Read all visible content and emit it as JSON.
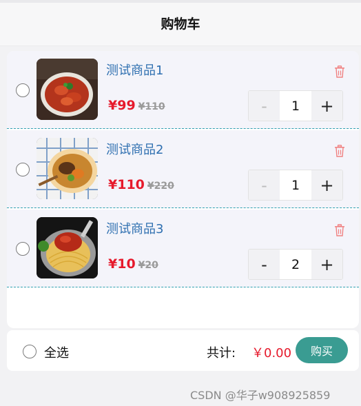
{
  "header": {
    "title": "购物车"
  },
  "items": [
    {
      "name": "测试商品1",
      "price": "¥99",
      "original_price": "¥110",
      "quantity": "1",
      "minus": "-",
      "plus": "+"
    },
    {
      "name": "测试商品2",
      "price": "¥110",
      "original_price": "¥220",
      "quantity": "1",
      "minus": "-",
      "plus": "+"
    },
    {
      "name": "测试商品3",
      "price": "¥10",
      "original_price": "¥20",
      "quantity": "2",
      "minus": "-",
      "plus": "+"
    }
  ],
  "footer": {
    "select_all_label": "全选",
    "total_label": "共计:",
    "total_value": "￥0.00",
    "buy_label": "购买"
  },
  "watermark": "CSDN @华子w908925859",
  "colors": {
    "accent": "#3a9c92",
    "price": "#e61a2c",
    "divider": "#2fa0b0"
  }
}
